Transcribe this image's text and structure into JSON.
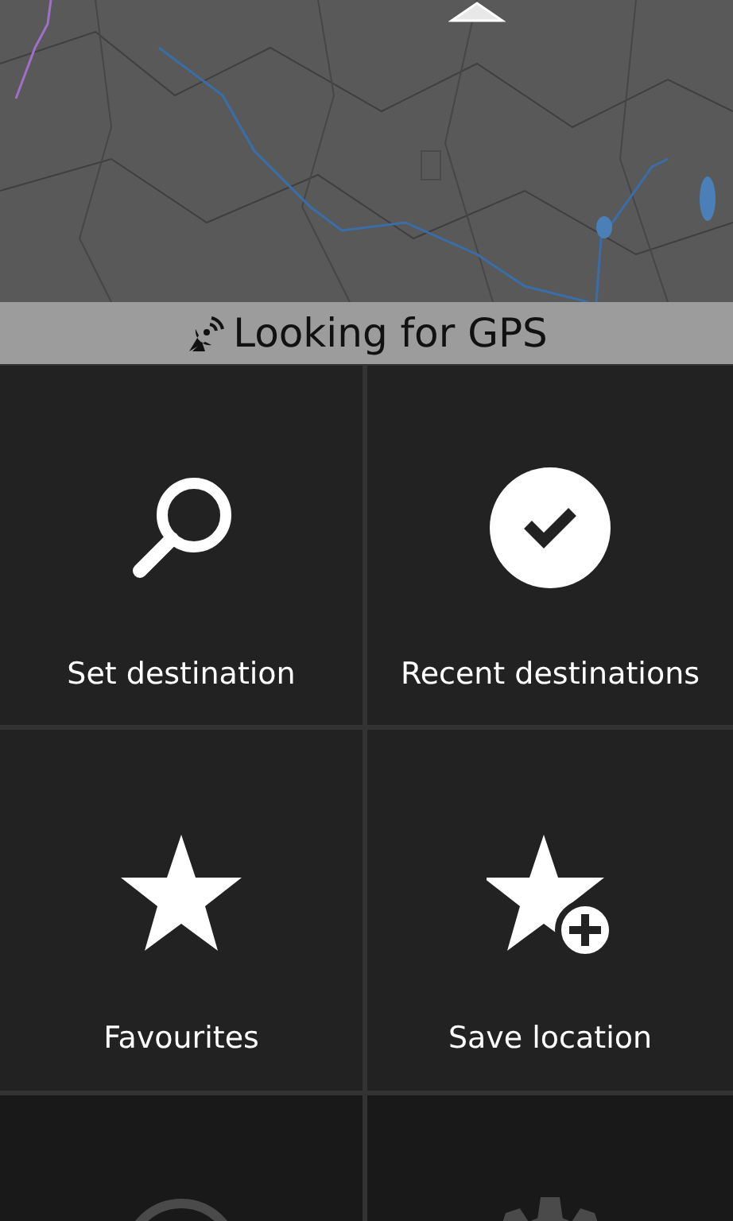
{
  "status_bar": {
    "text": "Looking for GPS"
  },
  "tiles": [
    {
      "kind": "search",
      "label": "Set destination",
      "disabled": false
    },
    {
      "kind": "check",
      "label": "Recent destinations",
      "disabled": false
    },
    {
      "kind": "star",
      "label": "Favourites",
      "disabled": false
    },
    {
      "kind": "starplus",
      "label": "Save location",
      "disabled": false
    },
    {
      "kind": "ring",
      "disabled": true
    },
    {
      "kind": "gear",
      "disabled": true
    }
  ]
}
